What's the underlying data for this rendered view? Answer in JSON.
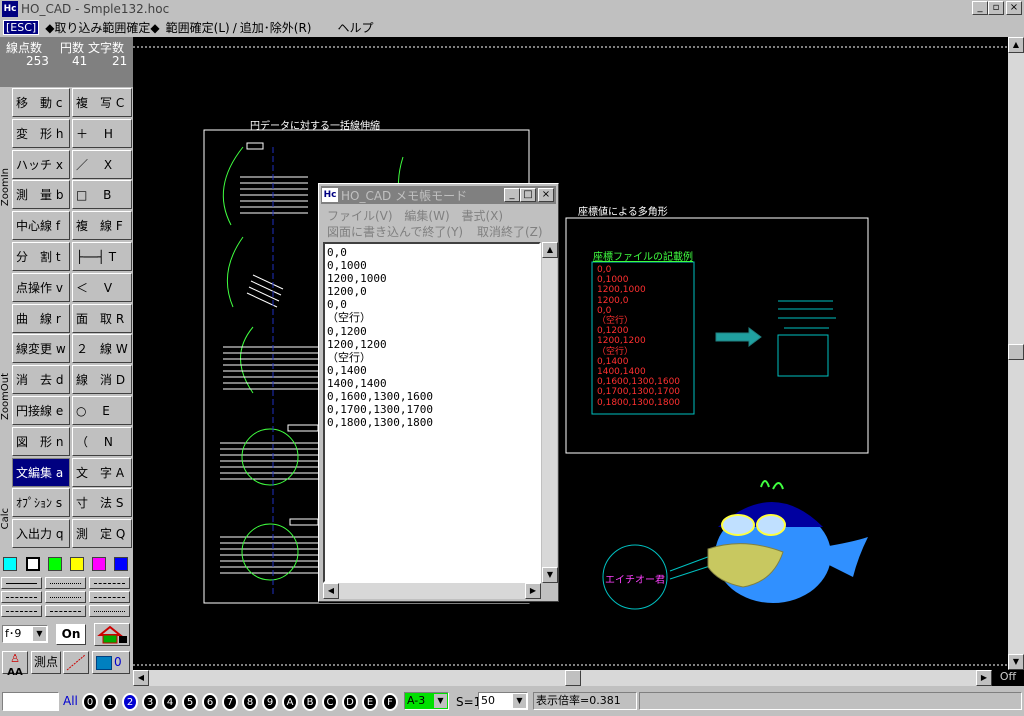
{
  "window": {
    "title": "HO_CAD - Smple132.hoc",
    "icon_label": "Hc",
    "minimize": "_",
    "maximize": "▫",
    "close": "×"
  },
  "menu": {
    "esc": "[ESC]",
    "items": [
      "◆取り込み範囲確定◆",
      "範囲確定(L)",
      "/",
      "追加･除外(R)",
      "ヘルプ"
    ]
  },
  "counts": {
    "headers": [
      "線点数",
      "円数",
      "文字数"
    ],
    "values": [
      "253",
      "41",
      "21"
    ]
  },
  "side_labels": {
    "zoom_in": "ZoomIn",
    "zoom_out": "ZoomOut",
    "calc": "Calc"
  },
  "commands": [
    [
      "移　動 c",
      "複　写 C"
    ],
    [
      "変　形 h",
      "＋　 H"
    ],
    [
      "ハッチ x",
      "／　 X"
    ],
    [
      "測　量 b",
      "□　 B"
    ],
    [
      "中心線 f",
      "複　線 F"
    ],
    [
      "分　割 t",
      "├──┤ T"
    ],
    [
      "点操作 v",
      "＜　 V"
    ],
    [
      "曲　線 r",
      "面　取 R"
    ],
    [
      "線変更 w",
      "２　線 W"
    ],
    [
      "消　去 d",
      "線　消 D"
    ],
    [
      "円接線 e",
      "○　 E"
    ],
    [
      "図　形 n",
      "（　 N"
    ],
    [
      "文編集 a",
      "文　字 A"
    ],
    [
      "ｵﾌﾟｼｮﾝ s",
      "寸　法 S"
    ],
    [
      "入出力 q",
      "測　定 Q"
    ]
  ],
  "selected_command": "文編集 a",
  "colors": {
    "swatches": [
      "#00ffff",
      "#ffffff",
      "#00ff00",
      "#ffff00",
      "#ff00ff",
      "#0000ff"
    ],
    "canvas_bg": "#000000",
    "accent": "#000080",
    "text_red": "#ff3030",
    "text_green": "#40ff40",
    "cyan": "#00c0c0"
  },
  "tools": {
    "font_select": "f･9",
    "on_button": "On",
    "sokuten": "測点",
    "layer_zero": "0",
    "aa": "AA"
  },
  "canvas": {
    "title_left": "円データに対する一括線伸縮",
    "title_right": "座標値による多角形",
    "sample_heading": "座標ファイルの記載例",
    "sample_lines": [
      "0,0",
      "0,1000",
      "1200,1000",
      "1200,0",
      "0,0",
      "（空行）",
      "0,1200",
      "1200,1200",
      "（空行）",
      "0,1400",
      "1400,1400",
      "0,1600,1300,1600",
      "0,1700,1300,1700",
      "0,1800,1300,1800"
    ],
    "mascot_label": "エイチオー君"
  },
  "memo": {
    "title": "HO_CAD メモ帳モード",
    "menu": [
      "ファイル(V)",
      "編集(W)",
      "書式(X)"
    ],
    "actions": [
      "図面に書き込んで終了(Y)",
      "取消終了(Z)"
    ],
    "text": "0,0\n0,1000\n1200,1000\n1200,0\n0,0\n（空行）\n0,1200\n1200,1200\n（空行）\n0,1400\n1400,1400\n0,1600,1300,1600\n0,1700,1300,1700\n0,1800,1300,1800"
  },
  "status": {
    "all": "All",
    "layers": [
      "0",
      "1",
      "2",
      "3",
      "4",
      "5",
      "6",
      "7",
      "8",
      "9",
      "A",
      "B",
      "C",
      "D",
      "E",
      "F"
    ],
    "active_layer": "2",
    "paper": "A-3",
    "scale_label": "S=1:",
    "scale_value": "50",
    "zoom": "表示倍率=0.381",
    "off": "Off"
  }
}
